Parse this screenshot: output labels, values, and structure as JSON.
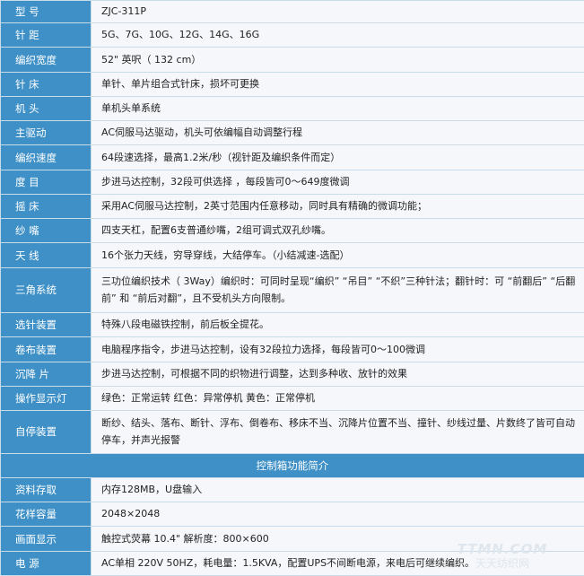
{
  "rows": [
    {
      "label": "型 号",
      "value": "ZJC-311P"
    },
    {
      "label": "针 距",
      "value": "5G、7G、10G、12G、14G、16G"
    },
    {
      "label": "编织宽度",
      "value": "52\" 英呎（ 132 cm）"
    },
    {
      "label": "针 床",
      "value": "单针、单片组合式针床，损坏可更换"
    },
    {
      "label": "机 头",
      "value": "单机头单系统"
    },
    {
      "label": "主驱动",
      "value": "AC伺服马达驱动，机头可依编幅自动调整行程"
    },
    {
      "label": "编织速度",
      "value": "64段速选择，最高1.2米/秒（视针距及编织条件而定）"
    },
    {
      "label": "度 目",
      "value": "步进马达控制，32段可供选择 ，每段皆可0～649度微调"
    },
    {
      "label": "摇 床",
      "value": "采用AC伺服马达控制，2英寸范围内任意移动，同时具有精确的微调功能；"
    },
    {
      "label": "纱 嘴",
      "value": "四支天杠，配置6支普通纱嘴，2组可调式双孔纱嘴。"
    },
    {
      "label": "天 线",
      "value": "16个张力天线，穷导穿线，大结停车。（小结减速-选配）"
    },
    {
      "label": "三角系统",
      "value": "三功位编织技术（ 3Way）编织时：可同时呈现“编织” “吊目” “不织”三种针法；翻针时：可 “前翻后” “后翻前” 和 “前后对翻”，且不受机头方向限制。"
    },
    {
      "label": "选针装置",
      "value": "特殊八段电磁铁控制，前后板全提花。"
    },
    {
      "label": "卷布装置",
      "value": "电脑程序指令，步进马达控制，设有32段拉力选择，每段皆可0～100微调"
    },
    {
      "label": "沉降 片",
      "value": "步进马达控制，可根据不同的织物进行调整，达到多种收、放针的效果"
    },
    {
      "label": "操作显示灯",
      "value": "绿色：正常运转 红色：异常停机 黄色：正常停机"
    },
    {
      "label": "自停装置",
      "value": "断纱、结头、落布、断针、浮布、倒卷布、移床不当、沉降片位置不当、撞针、纱线过量、片数终了皆可自动停车，并声光报警"
    }
  ],
  "section_title": "控制箱功能简介",
  "rows2": [
    {
      "label": "资料存取",
      "value": "内存128MB，U盘输入"
    },
    {
      "label": "花样容量",
      "value": "2048×2048"
    },
    {
      "label": "画面显示",
      "value": "触控式荧幕 10.4\" 解析度：800×600"
    },
    {
      "label": "电 源",
      "value": "AC单相 220V 50HZ，耗电量：1.5KVA，配置UPS不间断电源，来电后可继续编织。"
    }
  ],
  "watermark": {
    "line1": "TTMN.COM",
    "line2": "天天纺织网"
  },
  "colors": {
    "label_bg": "#3e90c7",
    "value_bg": "#f5f7fa",
    "border": "#c9dce9"
  }
}
